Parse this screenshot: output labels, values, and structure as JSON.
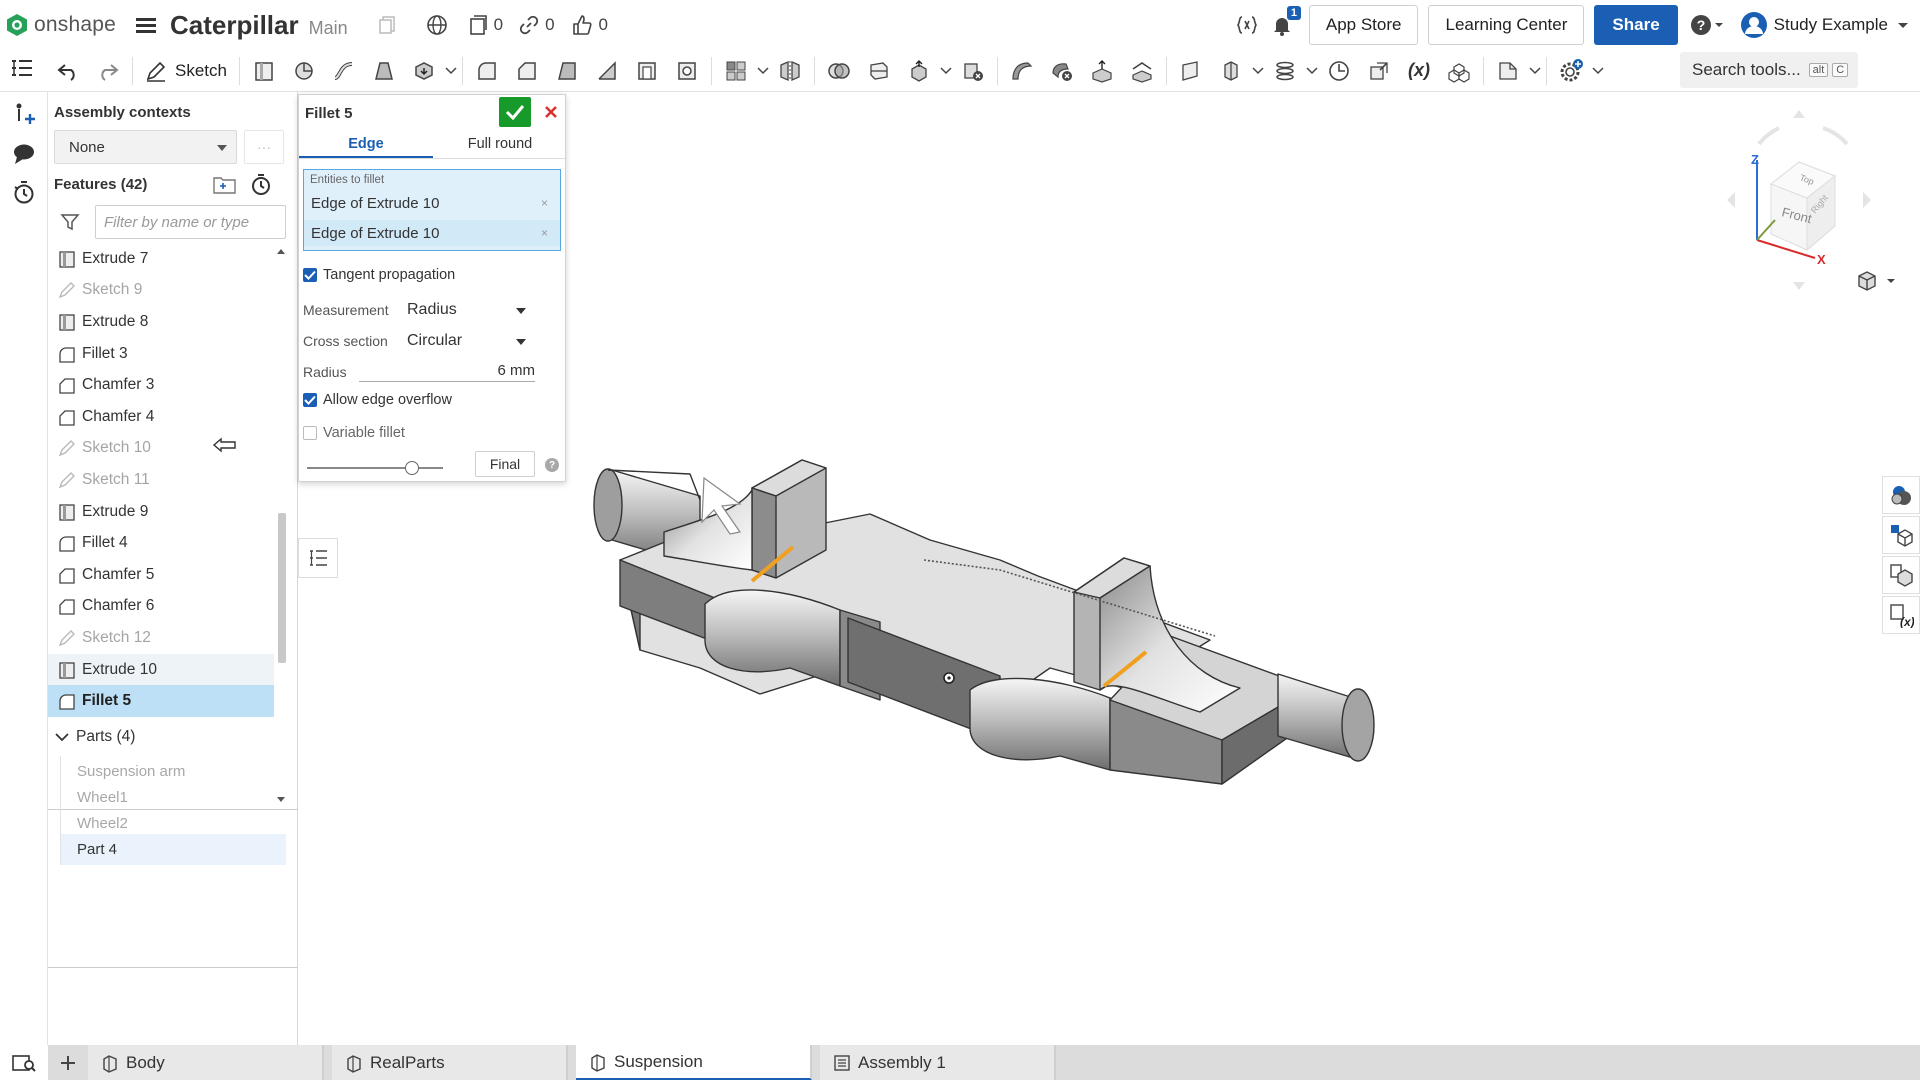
{
  "app": {
    "logo_text": "onshape",
    "document_title": "Caterpillar",
    "branch": "Main",
    "versions_count": "0",
    "links_count": "0",
    "likes_count": "0",
    "notifications_count": "1",
    "app_store_label": "App Store",
    "learning_center_label": "Learning Center",
    "share_label": "Share",
    "user_name": "Study Example"
  },
  "toolbar": {
    "sketch_label": "Sketch",
    "search_placeholder": "Search tools...",
    "search_kbd_1": "alt",
    "search_kbd_2": "C",
    "variable_label": "(x)"
  },
  "assembly_contexts": {
    "heading": "Assembly contexts",
    "selected": "None",
    "more": "···"
  },
  "features": {
    "heading": "Features (42)",
    "filter_placeholder": "Filter by name or type",
    "items": [
      {
        "label": "Extrude 7",
        "type": "extrude",
        "dim": false
      },
      {
        "label": "Sketch 9",
        "type": "sketch",
        "dim": true
      },
      {
        "label": "Extrude 8",
        "type": "extrude",
        "dim": false
      },
      {
        "label": "Fillet 3",
        "type": "fillet",
        "dim": false
      },
      {
        "label": "Chamfer 3",
        "type": "chamfer",
        "dim": false
      },
      {
        "label": "Chamfer 4",
        "type": "chamfer",
        "dim": false
      },
      {
        "label": "Sketch 10",
        "type": "sketch",
        "dim": true
      },
      {
        "label": "Sketch 11",
        "type": "sketch",
        "dim": true
      },
      {
        "label": "Extrude 9",
        "type": "extrude",
        "dim": false
      },
      {
        "label": "Fillet 4",
        "type": "fillet",
        "dim": false
      },
      {
        "label": "Chamfer 5",
        "type": "chamfer",
        "dim": false
      },
      {
        "label": "Chamfer 6",
        "type": "chamfer",
        "dim": false
      },
      {
        "label": "Sketch 12",
        "type": "sketch",
        "dim": true
      },
      {
        "label": "Extrude 10",
        "type": "extrude",
        "dim": false
      },
      {
        "label": "Fillet 5",
        "type": "fillet",
        "dim": false
      }
    ]
  },
  "parts": {
    "heading": "Parts (4)",
    "items": [
      "Suspension arm",
      "Wheel1",
      "Wheel2",
      "Part 4"
    ]
  },
  "fillet_dialog": {
    "title": "Fillet 5",
    "tab_edge": "Edge",
    "tab_full_round": "Full round",
    "entities_label": "Entities to fillet",
    "entities": [
      "Edge of Extrude 10",
      "Edge of Extrude 10"
    ],
    "entity_remove": "×",
    "tangent_propagation": "Tangent propagation",
    "tangent_propagation_checked": true,
    "measurement_label": "Measurement",
    "measurement_value": "Radius",
    "cross_section_label": "Cross section",
    "cross_section_value": "Circular",
    "radius_label": "Radius",
    "radius_value": "6 mm",
    "allow_edge_overflow": "Allow edge overflow",
    "allow_edge_overflow_checked": true,
    "variable_fillet": "Variable fillet",
    "variable_fillet_checked": false,
    "final_label": "Final",
    "help": "?"
  },
  "viewcube": {
    "top": "Top",
    "front": "Front",
    "right": "Right",
    "axis_x": "X",
    "axis_z": "Z"
  },
  "tabs": [
    {
      "label": "Body",
      "active": false
    },
    {
      "label": "RealParts",
      "active": false
    },
    {
      "label": "Suspension",
      "active": true
    },
    {
      "label": "Assembly 1",
      "active": false
    }
  ],
  "colors": {
    "accent": "#1a5fb4",
    "confirm": "#189a2a",
    "cancel": "#d9342b",
    "selection": "#bde0f7",
    "edge_highlight": "#f0a020"
  }
}
